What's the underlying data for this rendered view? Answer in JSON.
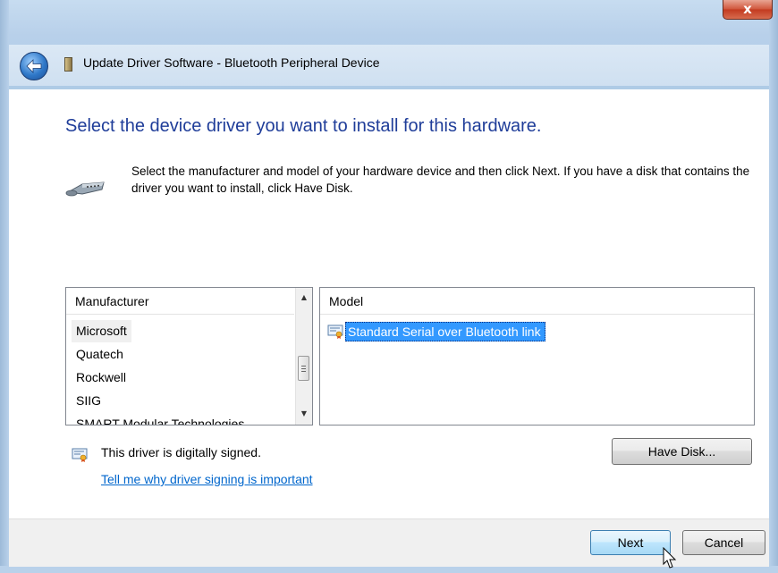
{
  "window": {
    "title": "Update Driver Software - Bluetooth Peripheral Device",
    "close_label": "x"
  },
  "page": {
    "heading": "Select the device driver you want to install for this hardware.",
    "description": "Select the manufacturer and model of your hardware device and then click Next. If you have a disk that contains the driver you want to install, click Have Disk."
  },
  "manufacturer_list": {
    "header": "Manufacturer",
    "items": [
      {
        "label": "Microsoft",
        "selected": true
      },
      {
        "label": "Quatech",
        "selected": false
      },
      {
        "label": "Rockwell",
        "selected": false
      },
      {
        "label": "SIIG",
        "selected": false
      },
      {
        "label": "SMART Modular Technologies",
        "selected": false
      }
    ]
  },
  "model_list": {
    "header": "Model",
    "items": [
      {
        "label": "Standard Serial over Bluetooth link",
        "selected": true
      }
    ]
  },
  "signing": {
    "status": "This driver is digitally signed.",
    "link": "Tell me why driver signing is important"
  },
  "buttons": {
    "have_disk": "Have Disk...",
    "next": "Next",
    "cancel": "Cancel"
  },
  "colors": {
    "heading": "#1f3d99",
    "link": "#0066cc",
    "selection": "#3399ff"
  },
  "icons": [
    "back-arrow-icon",
    "window-title-icon",
    "serial-port-icon",
    "driver-certificate-icon",
    "mouse-cursor-icon"
  ]
}
